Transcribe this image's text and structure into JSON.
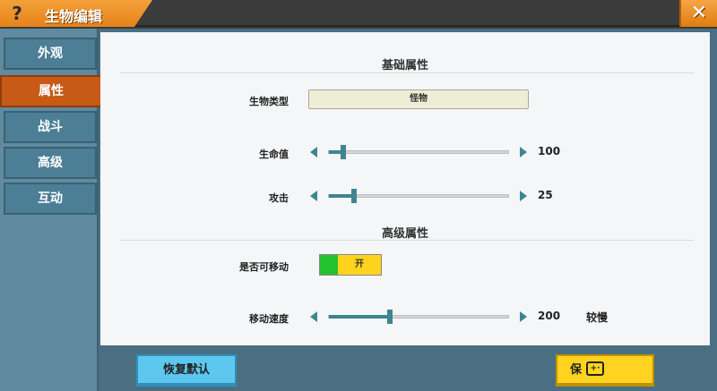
{
  "window": {
    "title": "生物编辑",
    "help_glyph": "?",
    "close_glyph": "✕"
  },
  "sidebar": {
    "tabs": [
      {
        "label": "外观"
      },
      {
        "label": "属性"
      },
      {
        "label": "战斗"
      },
      {
        "label": "高级"
      },
      {
        "label": "互动"
      }
    ]
  },
  "basic_section": {
    "title": "基础属性",
    "creature_type": {
      "label": "生物类型",
      "value": "怪物"
    }
  },
  "health": {
    "label": "生命值",
    "value": "100",
    "level": 0.08
  },
  "attack": {
    "label": "攻击",
    "value": "25",
    "level": 0.14
  },
  "advanced_section": {
    "title": "高级属性",
    "movable": {
      "label": "是否可移动",
      "state": "开",
      "on": true
    },
    "move_speed": {
      "label": "移动速度",
      "value": "200",
      "level": 0.34,
      "descriptor": "较慢"
    }
  },
  "footer": {
    "restore_label": "恢复默认",
    "save_label": "保"
  },
  "colors": {
    "accent_orange": "#e58318",
    "teal": "#3f8591",
    "tab_blue": "#5f8aa0",
    "active_tab": "#c75a16",
    "save_yellow": "#ffd31f",
    "restore_blue": "#5dc7f0"
  }
}
